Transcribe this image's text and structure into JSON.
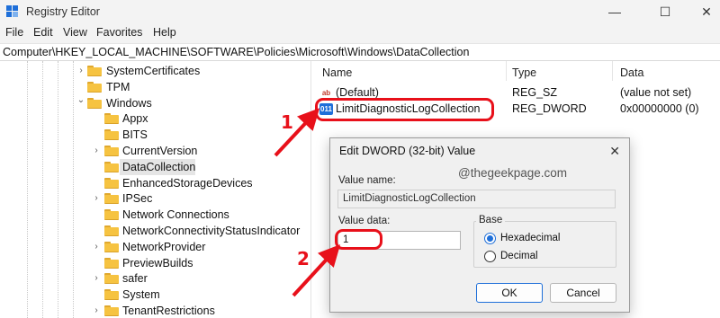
{
  "window": {
    "title": "Registry Editor",
    "minimize_glyph": "—",
    "maximize_glyph": "☐",
    "close_glyph": "✕"
  },
  "menu": [
    "File",
    "Edit",
    "View",
    "Favorites",
    "Help"
  ],
  "address": "Computer\\HKEY_LOCAL_MACHINE\\SOFTWARE\\Policies\\Microsoft\\Windows\\DataCollection",
  "tree": [
    {
      "label": "SystemCertificates",
      "expander": "collapsed"
    },
    {
      "label": "TPM",
      "expander": "none"
    },
    {
      "label": "Windows",
      "expander": "expanded"
    },
    {
      "label": "Appx",
      "expander": "none"
    },
    {
      "label": "BITS",
      "expander": "none"
    },
    {
      "label": "CurrentVersion",
      "expander": "collapsed"
    },
    {
      "label": "DataCollection",
      "expander": "none",
      "selected": true
    },
    {
      "label": "EnhancedStorageDevices",
      "expander": "none"
    },
    {
      "label": "IPSec",
      "expander": "collapsed"
    },
    {
      "label": "Network Connections",
      "expander": "none"
    },
    {
      "label": "NetworkConnectivityStatusIndicator",
      "expander": "none"
    },
    {
      "label": "NetworkProvider",
      "expander": "collapsed"
    },
    {
      "label": "PreviewBuilds",
      "expander": "none"
    },
    {
      "label": "safer",
      "expander": "collapsed"
    },
    {
      "label": "System",
      "expander": "none"
    },
    {
      "label": "TenantRestrictions",
      "expander": "collapsed"
    }
  ],
  "list": {
    "columns": [
      "Name",
      "Type",
      "Data"
    ],
    "rows": [
      {
        "icon": "string-value-icon",
        "icon_text": "ab",
        "name": "(Default)",
        "type": "REG_SZ",
        "data": "(value not set)"
      },
      {
        "icon": "dword-value-icon",
        "icon_text": "011",
        "name": "LimitDiagnosticLogCollection",
        "type": "REG_DWORD",
        "data": "0x00000000 (0)"
      }
    ]
  },
  "annotations": {
    "step1": "1",
    "step2": "2",
    "color": "#e8101a"
  },
  "dialog": {
    "title": "Edit DWORD (32-bit) Value",
    "close_glyph": "✕",
    "watermark": "@thegeekpage.com",
    "value_name_label": "Value name:",
    "value_name": "LimitDiagnosticLogCollection",
    "value_data_label": "Value data:",
    "value_data": "1",
    "base_label": "Base",
    "base_options": [
      {
        "label": "Hexadecimal",
        "checked": true
      },
      {
        "label": "Decimal",
        "checked": false
      }
    ],
    "ok_label": "OK",
    "cancel_label": "Cancel"
  },
  "colors": {
    "accent": "#1e6fd9",
    "folder": "#f6c341",
    "chrome": "#f3f3f3",
    "dialog": "#f0f0f0"
  }
}
